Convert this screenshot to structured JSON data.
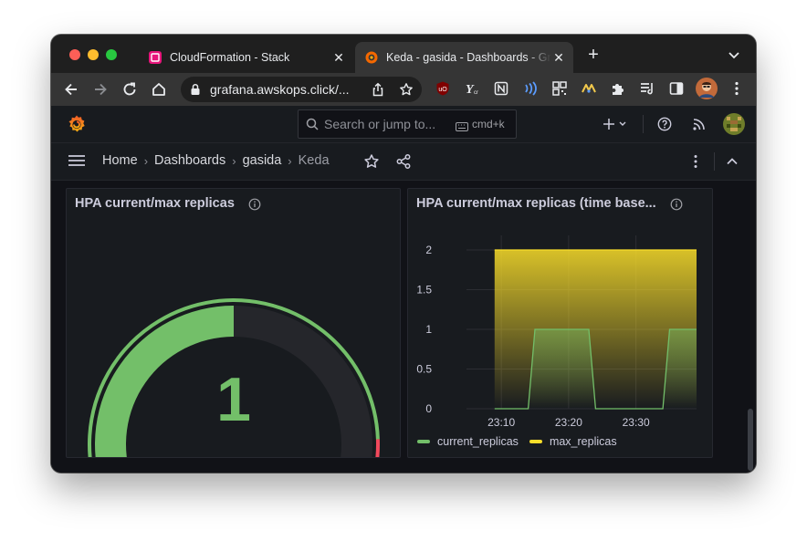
{
  "browser": {
    "tabs": [
      {
        "title": "CloudFormation - Stack",
        "icon": "cloudformation-icon",
        "active": false
      },
      {
        "title": "Keda - gasida - Dashboards - Grafana",
        "icon": "grafana-icon",
        "active": true
      }
    ],
    "url": "grafana.awskops.click/...",
    "close_glyph": "✕",
    "new_tab_glyph": "+"
  },
  "grafana": {
    "search": {
      "placeholder": "Search or jump to...",
      "shortcut": "cmd+k"
    },
    "breadcrumb": [
      {
        "label": "Home"
      },
      {
        "label": "Dashboards"
      },
      {
        "label": "gasida"
      },
      {
        "label": "Keda"
      }
    ],
    "separator": "›"
  },
  "panels": {
    "gauge": {
      "title": "HPA current/max replicas",
      "value": "1",
      "min": 0,
      "max": 2,
      "thresholds": [
        {
          "color": "#73bf69",
          "from": 0
        },
        {
          "color": "#f2495c",
          "from": 1.8
        }
      ],
      "color": "#73bf69"
    },
    "timeseries": {
      "title": "HPA current/max replicas (time base..."
    }
  },
  "chart_data": {
    "type": "area",
    "x": [
      "23:07",
      "23:09",
      "23:14",
      "23:15",
      "23:23",
      "23:24",
      "23:29",
      "23:30",
      "23:34",
      "23:35",
      "23:39"
    ],
    "xticks": [
      "23:10",
      "23:20",
      "23:30"
    ],
    "yticks": [
      "0",
      "0.5",
      "1",
      "1.5",
      "2"
    ],
    "ylim": [
      0,
      2
    ],
    "xlim": [
      "23:07",
      "23:39"
    ],
    "grid": true,
    "legend": "bottom-left",
    "series": [
      {
        "name": "current_replicas",
        "color": "#73bf69",
        "values": [
          null,
          0,
          0,
          1,
          1,
          0,
          0,
          0,
          0,
          1,
          1
        ]
      },
      {
        "name": "max_replicas",
        "color": "#fade2a",
        "values": [
          null,
          2,
          2,
          2,
          2,
          2,
          2,
          2,
          2,
          2,
          2
        ]
      }
    ]
  }
}
